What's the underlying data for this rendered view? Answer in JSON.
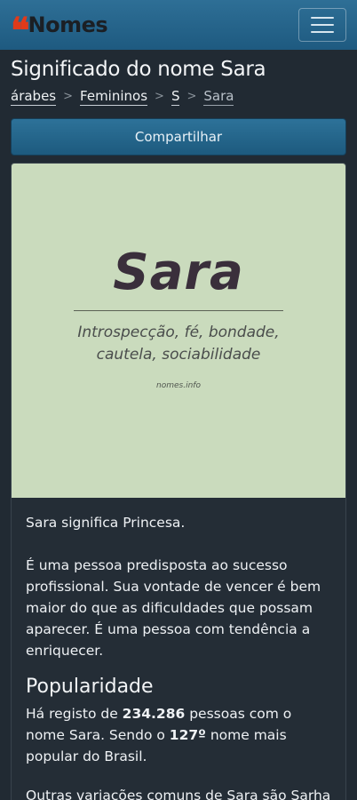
{
  "header": {
    "logo_quote": "❝",
    "logo_text": "Nomes",
    "menu_icon": "hamburger-icon"
  },
  "page": {
    "title": "Significado do nome Sara"
  },
  "breadcrumb": {
    "items": [
      "árabes",
      "Femininos",
      "S",
      "Sara"
    ],
    "separator": ">"
  },
  "share": {
    "label": "Compartilhar"
  },
  "name_image": {
    "name": "Sara",
    "traits": "Introspecção, fé, bondade, cautela, sociabilidade",
    "watermark": "nomes.info",
    "background": "#cadbbd"
  },
  "article": {
    "meaning": "Sara significa Princesa.",
    "personality": "É uma pessoa predisposta ao sucesso profissional. Sua vontade de vencer é bem maior do que as dificuldades que possam aparecer. É uma pessoa com tendência a enriquecer.",
    "popularity_heading": "Popularidade",
    "pop_1": "Há registo de ",
    "pop_count": "234.286",
    "pop_2": " pessoas com o nome Sara. Sendo o ",
    "pop_rank": "127º",
    "pop_3": " nome mais popular do Brasil.",
    "variations": "Outras variações comuns de Sara são Sarha"
  },
  "colors": {
    "navbar": "#2a6a91",
    "background": "#212a33",
    "logo_quote": "#e03a1a"
  }
}
